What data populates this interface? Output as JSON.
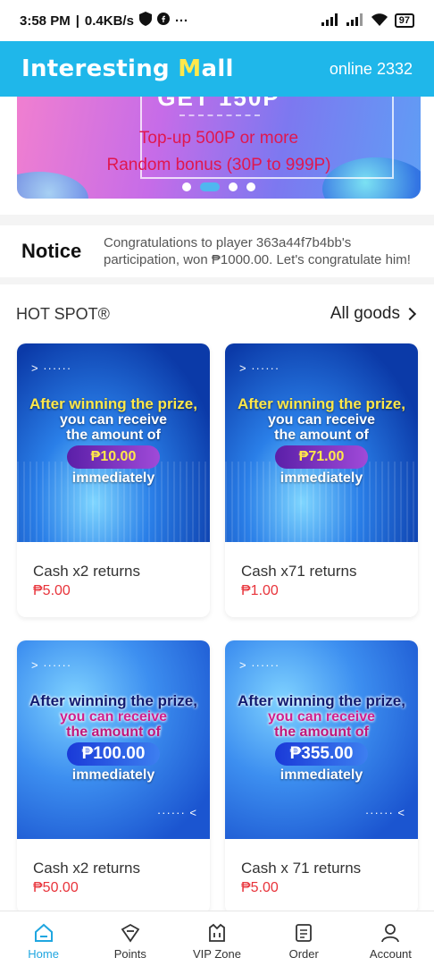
{
  "status_bar": {
    "time": "3:58 PM",
    "speed": "0.4KB/s",
    "dots": "···",
    "battery": "97"
  },
  "app_bar": {
    "title_a": "Interesting ",
    "title_b": "M",
    "title_c": "all",
    "online": "online 2332"
  },
  "banner": {
    "headline": "GET 150P",
    "line1": "Top-up 500P or more",
    "line2": "Random bonus (30P to 999P)",
    "page_count": 4,
    "active_page": 1
  },
  "notice": {
    "label": "Notice",
    "text": "Congratulations to player 363a44f7b4bb's participation, won ₱1000.00. Let's congratulate him!"
  },
  "hot_spot": {
    "title": "HOT SPOT®",
    "all_goods": "All goods",
    "products": [
      {
        "img_line1": "After winning the prize,",
        "img_line2": "you can receive",
        "img_line3": "the amount of",
        "img_amount": "₱10.00",
        "img_line4": "immediately",
        "name": "Cash x2 returns",
        "price": "₱5.00"
      },
      {
        "img_line1": "After winning the prize,",
        "img_line2": "you can receive",
        "img_line3": "the amount of",
        "img_amount": "₱71.00",
        "img_line4": "immediately",
        "name": "Cash x71 returns",
        "price": "₱1.00"
      },
      {
        "img_line1": "After winning the prize,",
        "img_line2": "you can receive",
        "img_line3": "the amount of",
        "img_amount": "₱100.00",
        "img_line4": "immediately",
        "name": "Cash x2 returns",
        "price": "₱50.00"
      },
      {
        "img_line1": "After winning the prize,",
        "img_line2": "you can receive",
        "img_line3": "the amount of",
        "img_amount": "₱355.00",
        "img_line4": "immediately",
        "name": "Cash x 71 returns",
        "price": "₱5.00"
      }
    ]
  },
  "tabs": [
    {
      "label": "Home",
      "icon": "home-icon",
      "active": true
    },
    {
      "label": "Points",
      "icon": "points-icon",
      "active": false
    },
    {
      "label": "VIP Zone",
      "icon": "vip-icon",
      "active": false
    },
    {
      "label": "Order",
      "icon": "order-icon",
      "active": false
    },
    {
      "label": "Account",
      "icon": "account-icon",
      "active": false
    }
  ],
  "colors": {
    "accent": "#1fb7ea",
    "price": "#e8333a",
    "active_tab": "#1fa6e0"
  }
}
